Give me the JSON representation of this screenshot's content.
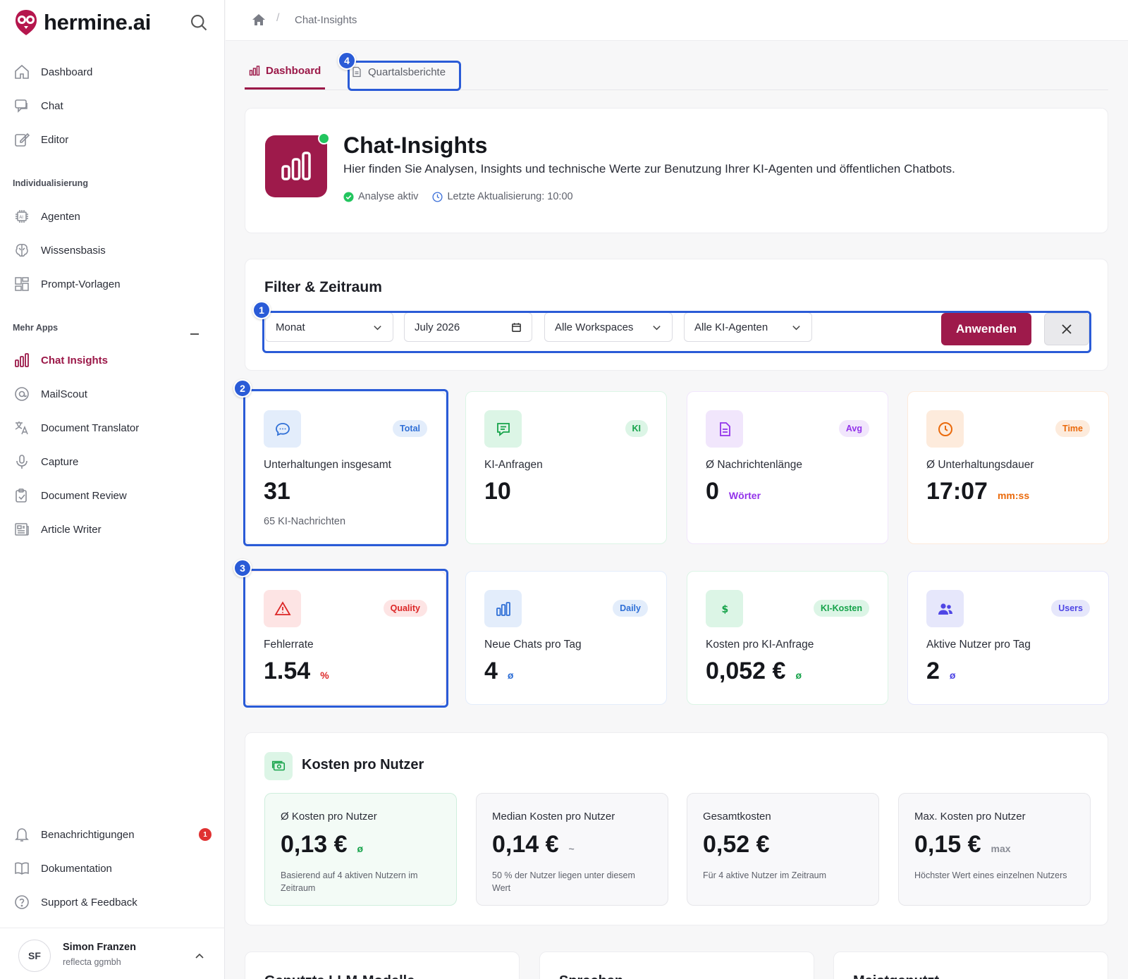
{
  "app": {
    "brand": "hermine.ai"
  },
  "sidebar": {
    "main": [
      {
        "label": "Dashboard",
        "icon": "home-icon"
      },
      {
        "label": "Chat",
        "icon": "chat-icon"
      },
      {
        "label": "Editor",
        "icon": "edit-icon"
      }
    ],
    "section_custom": "Individualisierung",
    "custom": [
      {
        "label": "Agenten",
        "icon": "ai-chip-icon"
      },
      {
        "label": "Wissensbasis",
        "icon": "brain-icon"
      },
      {
        "label": "Prompt-Vorlagen",
        "icon": "template-icon"
      }
    ],
    "section_apps": "Mehr Apps",
    "apps": [
      {
        "label": "Chat Insights",
        "icon": "bar-chart-icon"
      },
      {
        "label": "MailScout",
        "icon": "at-icon"
      },
      {
        "label": "Document Translator",
        "icon": "translate-icon"
      },
      {
        "label": "Capture",
        "icon": "microphone-icon"
      },
      {
        "label": "Document Review",
        "icon": "clipboard-icon"
      },
      {
        "label": "Article Writer",
        "icon": "newspaper-icon"
      }
    ],
    "footer": [
      {
        "label": "Benachrichtigungen",
        "icon": "bell-icon",
        "badge": "1"
      },
      {
        "label": "Dokumentation",
        "icon": "book-icon"
      },
      {
        "label": "Support & Feedback",
        "icon": "help-icon"
      }
    ],
    "user": {
      "initials": "SF",
      "name": "Simon Franzen",
      "org": "reflecta ggmbh"
    }
  },
  "breadcrumb": {
    "current": "Chat-Insights"
  },
  "tabs": [
    {
      "label": "Dashboard",
      "active": true
    },
    {
      "label": "Quartalsberichte",
      "active": false
    }
  ],
  "hero": {
    "title": "Chat-Insights",
    "subtitle": "Hier finden Sie Analysen, Insights und technische Werte zur Benutzung Ihrer KI-Agenten und öffentlichen Chatbots.",
    "status": "Analyse aktiv",
    "updated": "Letzte Aktualisierung: 10:00"
  },
  "filter": {
    "title": "Filter & Zeitraum",
    "period": "Monat",
    "date": "July 2026",
    "workspace": "Alle Workspaces",
    "agents": "Alle KI-Agenten",
    "apply": "Anwenden"
  },
  "stats": [
    {
      "badge": "Total",
      "label": "Unterhaltungen insgesamt",
      "value": "31",
      "unit": "",
      "sub": "65 KI-Nachrichten",
      "color": "#2f6fd6",
      "bg": "#e3edfb"
    },
    {
      "badge": "KI",
      "label": "KI-Anfragen",
      "value": "10",
      "unit": "",
      "sub": "",
      "color": "#16a34a",
      "bg": "#dcf5e6"
    },
    {
      "badge": "Avg",
      "label": "Ø Nachrichtenlänge",
      "value": "0",
      "unit": "Wörter",
      "sub": "",
      "color": "#9333ea",
      "bg": "#f1e6fc"
    },
    {
      "badge": "Time",
      "label": "Ø Unterhaltungsdauer",
      "value": "17:07",
      "unit": "mm:ss",
      "sub": "",
      "color": "#ea6a0c",
      "bg": "#fdebdc"
    },
    {
      "badge": "Quality",
      "label": "Fehlerrate",
      "value": "1.54",
      "unit": "%",
      "sub": "",
      "color": "#dc2626",
      "bg": "#fde4e4"
    },
    {
      "badge": "Daily",
      "label": "Neue Chats pro Tag",
      "value": "4",
      "unit": "ø",
      "sub": "",
      "color": "#2f6fd6",
      "bg": "#e3edfb"
    },
    {
      "badge": "KI-Kosten",
      "label": "Kosten pro KI-Anfrage",
      "value": "0,052 €",
      "unit": "ø",
      "sub": "",
      "color": "#16a34a",
      "bg": "#dcf5e6"
    },
    {
      "badge": "Users",
      "label": "Aktive Nutzer pro Tag",
      "value": "2",
      "unit": "ø",
      "sub": "",
      "color": "#4f46e5",
      "bg": "#e6e7fb"
    }
  ],
  "costs": {
    "title": "Kosten pro Nutzer",
    "items": [
      {
        "label": "Ø Kosten pro Nutzer",
        "value": "0,13 €",
        "unit": "ø",
        "note": "Basierend auf 4 aktiven Nutzern im Zeitraum"
      },
      {
        "label": "Median Kosten pro Nutzer",
        "value": "0,14 €",
        "unit": "~",
        "note": "50 % der Nutzer liegen unter diesem Wert"
      },
      {
        "label": "Gesamtkosten",
        "value": "0,52 €",
        "unit": "",
        "note": "Für 4 aktive Nutzer im Zeitraum"
      },
      {
        "label": "Max. Kosten pro Nutzer",
        "value": "0,15 €",
        "unit": "max",
        "note": "Höchster Wert eines einzelnen Nutzers"
      }
    ]
  },
  "bottom_cards": [
    "Genutzte LLM-Modelle",
    "Sprachen",
    "Meistgenutzt"
  ],
  "markers": [
    "1",
    "2",
    "3",
    "4"
  ]
}
